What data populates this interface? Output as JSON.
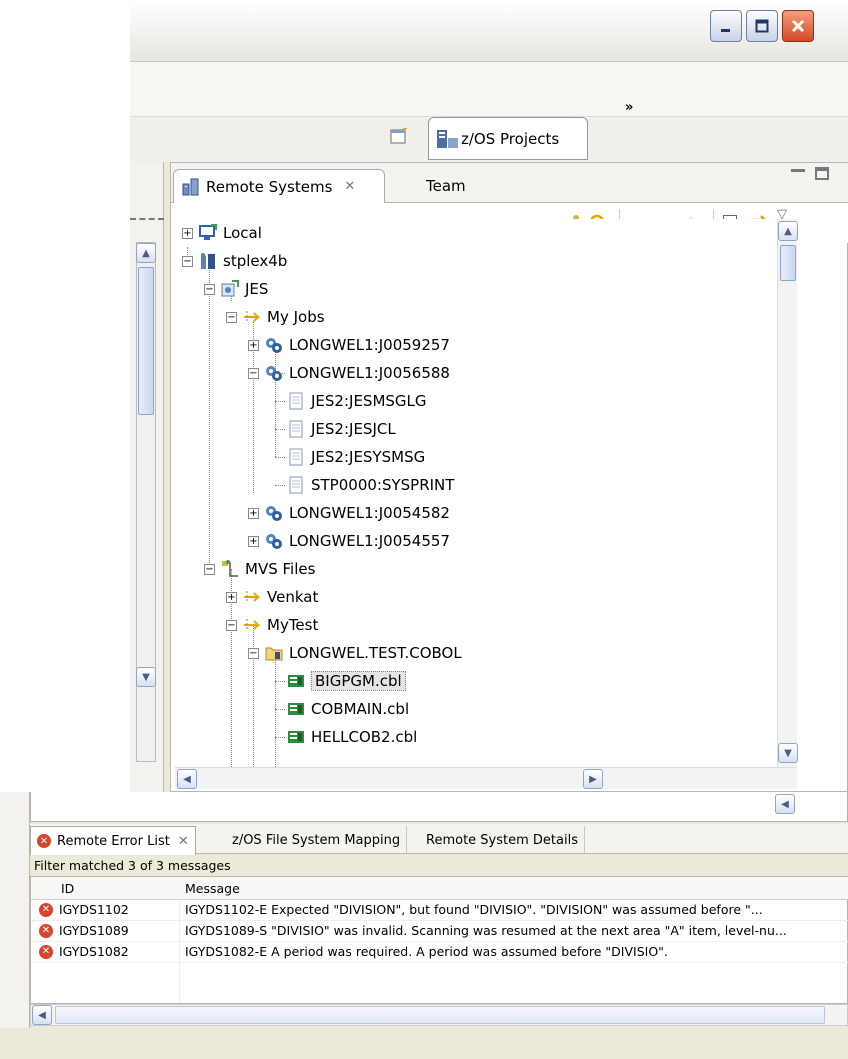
{
  "perspective": {
    "label": "z/OS Projects",
    "more": "»"
  },
  "views": {
    "remote_systems": {
      "tab_label": "Remote Systems",
      "team_tab_label": "Team"
    }
  },
  "tree": [
    {
      "label": "Local",
      "icon": "local-computer-icon"
    },
    {
      "label": "stplex4b",
      "icon": "server-icon"
    },
    {
      "label": "JES",
      "icon": "jes-subsystem-icon"
    },
    {
      "label": "My Jobs",
      "icon": "filter-arrow-icon"
    },
    {
      "label": "LONGWEL1:J0059257",
      "icon": "job-gears-icon"
    },
    {
      "label": "LONGWEL1:J0056588",
      "icon": "job-gears-icon"
    },
    {
      "label": "JES2:JESMSGLG",
      "icon": "spool-file-icon"
    },
    {
      "label": "JES2:JESJCL",
      "icon": "spool-file-icon"
    },
    {
      "label": "JES2:JESYSMSG",
      "icon": "spool-file-icon"
    },
    {
      "label": "STP0000:SYSPRINT",
      "icon": "spool-file-icon"
    },
    {
      "label": "LONGWEL1:J0054582",
      "icon": "job-gears-icon"
    },
    {
      "label": "LONGWEL1:J0054557",
      "icon": "job-gears-icon"
    },
    {
      "label": "MVS Files",
      "icon": "mvs-files-icon"
    },
    {
      "label": "Venkat",
      "icon": "filter-arrow-icon"
    },
    {
      "label": "MyTest",
      "icon": "filter-arrow-icon"
    },
    {
      "label": "LONGWEL.TEST.COBOL",
      "icon": "dataset-folder-icon"
    },
    {
      "label": "BIGPGM.cbl",
      "icon": "cobol-member-icon"
    },
    {
      "label": "COBMAIN.cbl",
      "icon": "cobol-member-icon"
    },
    {
      "label": "HELLCOB2.cbl",
      "icon": "cobol-member-icon"
    }
  ],
  "error_list": {
    "tabs": [
      "Remote Error List",
      "z/OS File System Mapping",
      "Remote System Details"
    ],
    "filter_text": "Filter matched 3 of 3 messages",
    "columns": [
      "ID",
      "Message"
    ],
    "rows": [
      {
        "id": "IGYDS1102",
        "message": "IGYDS1102-E Expected \"DIVISION\", but found \"DIVISIO\".  \"DIVISION\" was assumed before \"..."
      },
      {
        "id": "IGYDS1089",
        "message": "IGYDS1089-S \"DIVISIO\" was invalid.  Scanning was resumed at the next area \"A\" item, level-nu..."
      },
      {
        "id": "IGYDS1082",
        "message": "IGYDS1082-E A period was required.  A period was assumed before \"DIVISIO\"."
      }
    ]
  },
  "colors": {
    "error_red": "#d8452c",
    "selection_gray": "#e5e5e5",
    "chrome_beige": "#ece9d8"
  }
}
